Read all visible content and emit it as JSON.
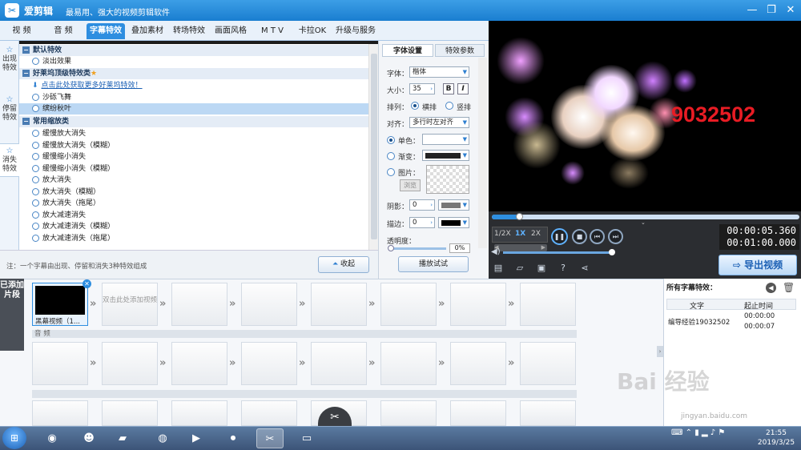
{
  "titlebar": {
    "app_name": "爱剪辑",
    "slogan": "最易用、强大的视频剪辑软件",
    "icon": "app-logo-icon"
  },
  "tabs": [
    "视  频",
    "音  频",
    "字幕特效",
    "叠加素材",
    "转场特效",
    "画面风格",
    "M T V",
    "卡拉OK",
    "升级与服务"
  ],
  "active_tab": "字幕特效",
  "left_vtabs": [
    {
      "label": "出现特效",
      "icon": "star-icon"
    },
    {
      "label": "停留特效",
      "icon": "star-icon"
    },
    {
      "label": "消失特效",
      "icon": "star-icon"
    }
  ],
  "effects": {
    "group_default": "默认特效",
    "fade": "淡出效果",
    "group_hollywood": "好莱坞顶级特效类",
    "download_link": "点击此处获取更多好莱坞特效！",
    "sand": "沙砾飞舞",
    "confetti": "缤纷秋叶",
    "group_zoom": "常用缩放类",
    "items": [
      "缓慢放大消失",
      "缓慢放大消失（模糊）",
      "缓慢缩小消失",
      "缓慢缩小消失（模糊）",
      "放大消失",
      "放大消失（模糊）",
      "放大消失（拖尾）",
      "放大减速消失",
      "放大减速消失（模糊）",
      "放大减速消失（拖尾）"
    ]
  },
  "note": "注：一个字幕由出现、停留和消失3种特效组成",
  "collapse_label": "收起",
  "props": {
    "tab_font": "字体设置",
    "tab_effect": "特效参数",
    "font_label": "字体：",
    "font_value": "楷体",
    "size_label": "大小：",
    "size_value": "35",
    "bold": "B",
    "italic": "I",
    "arrange_label": "排列：",
    "horizontal": "横排",
    "vertical": "竖排",
    "align_label": "对齐：",
    "align_value": "多行时左对齐",
    "single_color": "单色：",
    "gradient": "渐变：",
    "picture": "图片：",
    "browse": "浏览",
    "shadow_label": "阴影：",
    "shadow_value": "0",
    "stroke_label": "描边：",
    "stroke_value": "0",
    "opacity_label": "透明度：",
    "opacity_value": "0%",
    "play_test": "播放试试"
  },
  "preview": {
    "subtitle": "9032502"
  },
  "player": {
    "speeds": [
      "1/2X",
      "1X",
      "2X"
    ],
    "time_current": "00:00:05.360",
    "time_total": "00:01:00.000",
    "export_label": "导出视频"
  },
  "timeline": {
    "added_tab": "已添加片段",
    "first_clip": "黑幕视频（1...",
    "add_hint": "双击此处添加视频",
    "audio_label": "音  频"
  },
  "all_effects": {
    "title": "所有字幕特效：",
    "col_text": "文字",
    "col_time": "起止时间",
    "row_text": "编导经验19032502",
    "row_start": "00:00:00",
    "row_end": "00:00:07"
  },
  "taskbar": {
    "time": "21:55",
    "date": "2019/3/25"
  },
  "watermark": {
    "brand": "Bai 经验",
    "url": "jingyan.baidu.com"
  }
}
